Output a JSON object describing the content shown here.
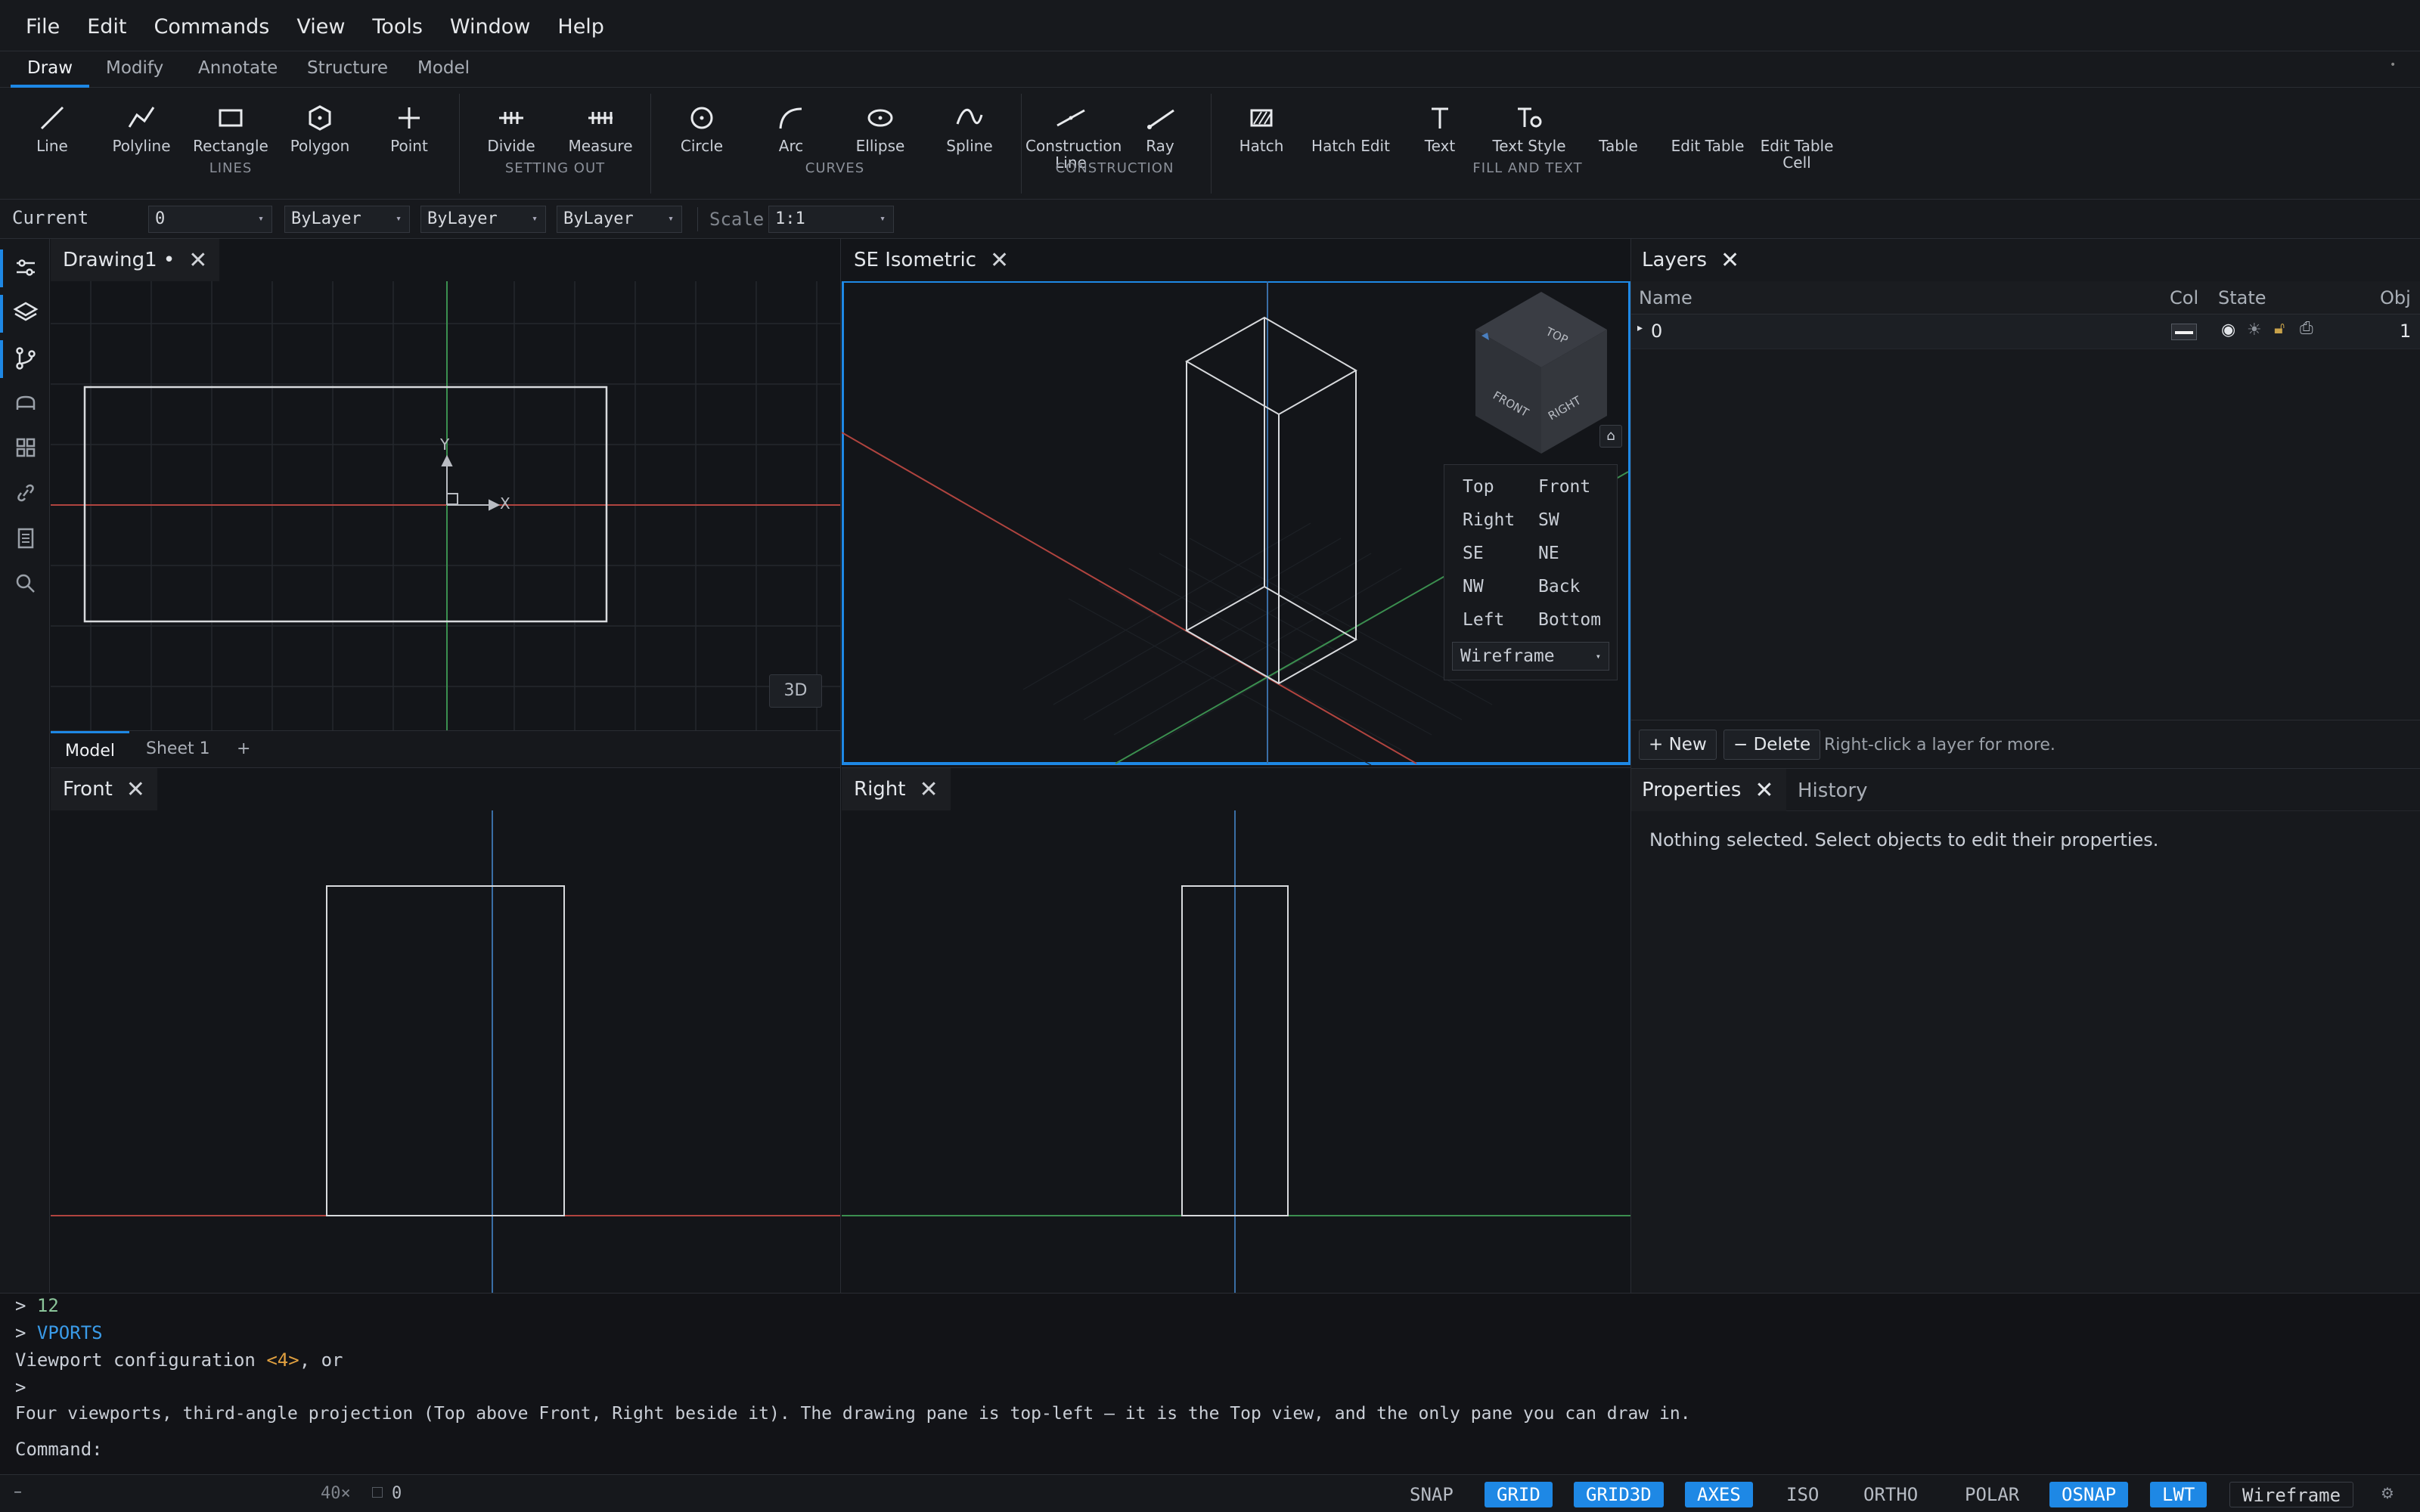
{
  "menu": [
    "File",
    "Edit",
    "Commands",
    "View",
    "Tools",
    "Window",
    "Help"
  ],
  "ribbon_tabs": [
    "Draw",
    "Modify",
    "Annotate",
    "Structure",
    "Model"
  ],
  "ribbon": {
    "tools": {
      "line": "Line",
      "polyline": "Polyline",
      "rectangle": "Rectangle",
      "polygon": "Polygon",
      "point": "Point",
      "divide": "Divide",
      "measure": "Measure",
      "circle": "Circle",
      "arc": "Arc",
      "ellipse": "Ellipse",
      "spline": "Spline",
      "construction_line": "Construction Line",
      "ray": "Ray",
      "hatch": "Hatch",
      "hatch_edit": "Hatch Edit",
      "text": "Text",
      "text_style": "Text Style",
      "table": "Table",
      "edit_table": "Edit Table",
      "edit_table_cell": "Edit Table Cell"
    },
    "groups": [
      "LINES",
      "SETTING OUT",
      "CURVES",
      "CONSTRUCTION",
      "FILL AND TEXT"
    ]
  },
  "propbar": {
    "current_label": "Current",
    "layer": "0",
    "color": "ByLayer",
    "linetype": "ByLayer",
    "lineweight": "ByLayer",
    "scale_label": "Scale",
    "scale": "1:1"
  },
  "viewports": {
    "top_title": "Drawing1 •",
    "iso_title": "SE Isometric",
    "front_title": "Front",
    "right_title": "Right",
    "btn_3d": "3D",
    "axis_x": "X",
    "axis_y": "Y",
    "sheet_tabs": [
      "Model",
      "Sheet 1"
    ],
    "add_sheet": "+"
  },
  "viewcube": {
    "faces": {
      "top": "TOP",
      "front": "FRONT",
      "right": "RIGHT"
    },
    "views": [
      "Top",
      "Front",
      "Right",
      "SW",
      "SE",
      "NE",
      "NW",
      "Back",
      "Left",
      "Bottom"
    ],
    "style": "Wireframe"
  },
  "layers": {
    "title": "Layers",
    "columns": {
      "name": "Name",
      "col": "Col",
      "state": "State",
      "obj": "Obj"
    },
    "rows": [
      {
        "name": "0",
        "obj": "1"
      }
    ],
    "new_btn": "+ New",
    "delete_btn": "− Delete",
    "hint": "Right-click a layer for more."
  },
  "properties": {
    "title": "Properties",
    "history_tab": "History",
    "empty": "Nothing selected. Select objects to edit their properties."
  },
  "command": {
    "lines": [
      {
        "prompt": ">",
        "text": "12"
      },
      {
        "prompt": ">",
        "text": "VPORTS"
      },
      {
        "pre": "Viewport configuration ",
        "hl": "<4>",
        "post": ", or"
      },
      {
        "prompt": ">",
        "text": ""
      },
      {
        "text": "Four viewports, third-angle projection (Top above Front, Right beside it). The drawing pane is top-left — it is the Top view, and the only pane you can draw in."
      }
    ],
    "input_label": "Command:"
  },
  "status": {
    "left_dash": "–",
    "zoom": "40×",
    "sel_count": "0",
    "toggles": [
      {
        "label": "SNAP",
        "on": false
      },
      {
        "label": "GRID",
        "on": true
      },
      {
        "label": "GRID3D",
        "on": true
      },
      {
        "label": "AXES",
        "on": true
      },
      {
        "label": "ISO",
        "on": false
      },
      {
        "label": "ORTHO",
        "on": false
      },
      {
        "label": "POLAR",
        "on": false
      },
      {
        "label": "OSNAP",
        "on": true
      },
      {
        "label": "LWT",
        "on": true
      }
    ],
    "render_mode": "Wireframe"
  },
  "colors": {
    "accent": "#1e88e5",
    "x_axis": "#c0504d",
    "y_axis": "#3f9a55",
    "z_axis": "#3a6ea5"
  }
}
